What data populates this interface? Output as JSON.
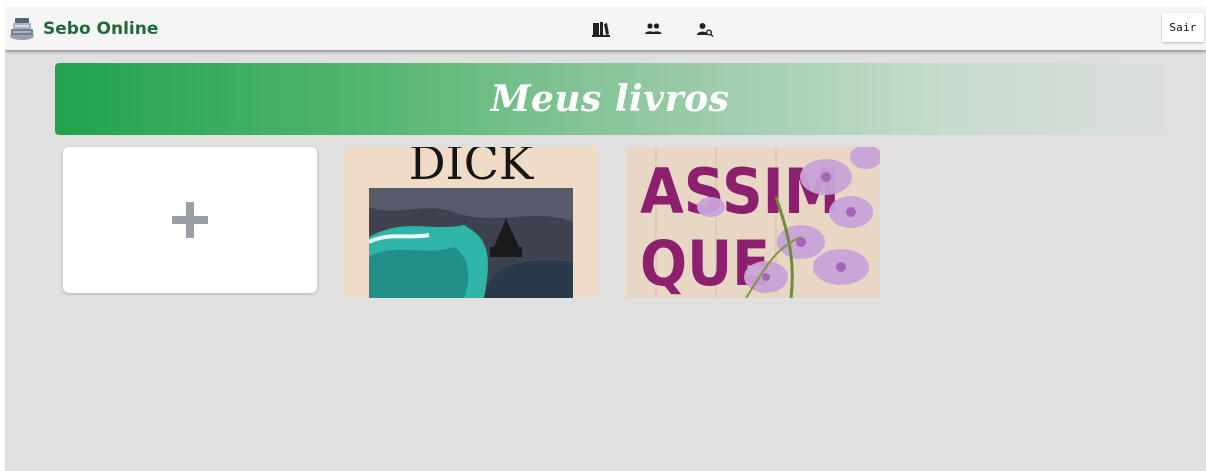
{
  "navbar": {
    "brand_name": "Sebo Online",
    "icons": [
      "books-icon",
      "group-icon",
      "user-search-icon"
    ],
    "logout_label": "Sair"
  },
  "banner": {
    "title": "Meus livros"
  },
  "books": [
    {
      "cover_title": "DICK",
      "cover_colors": [
        "#f0dcc6",
        "#151515",
        "#2fb5a8",
        "#3c3f4a"
      ]
    },
    {
      "cover_title_lines": [
        "ASSIM",
        "QUE"
      ],
      "cover_colors": [
        "#e9d7c6",
        "#8c1f6e",
        "#c9a3d8"
      ]
    }
  ],
  "colors": {
    "brand": "#1e6b3a",
    "banner_start": "#21a34e",
    "background": "#e0e0e0"
  }
}
